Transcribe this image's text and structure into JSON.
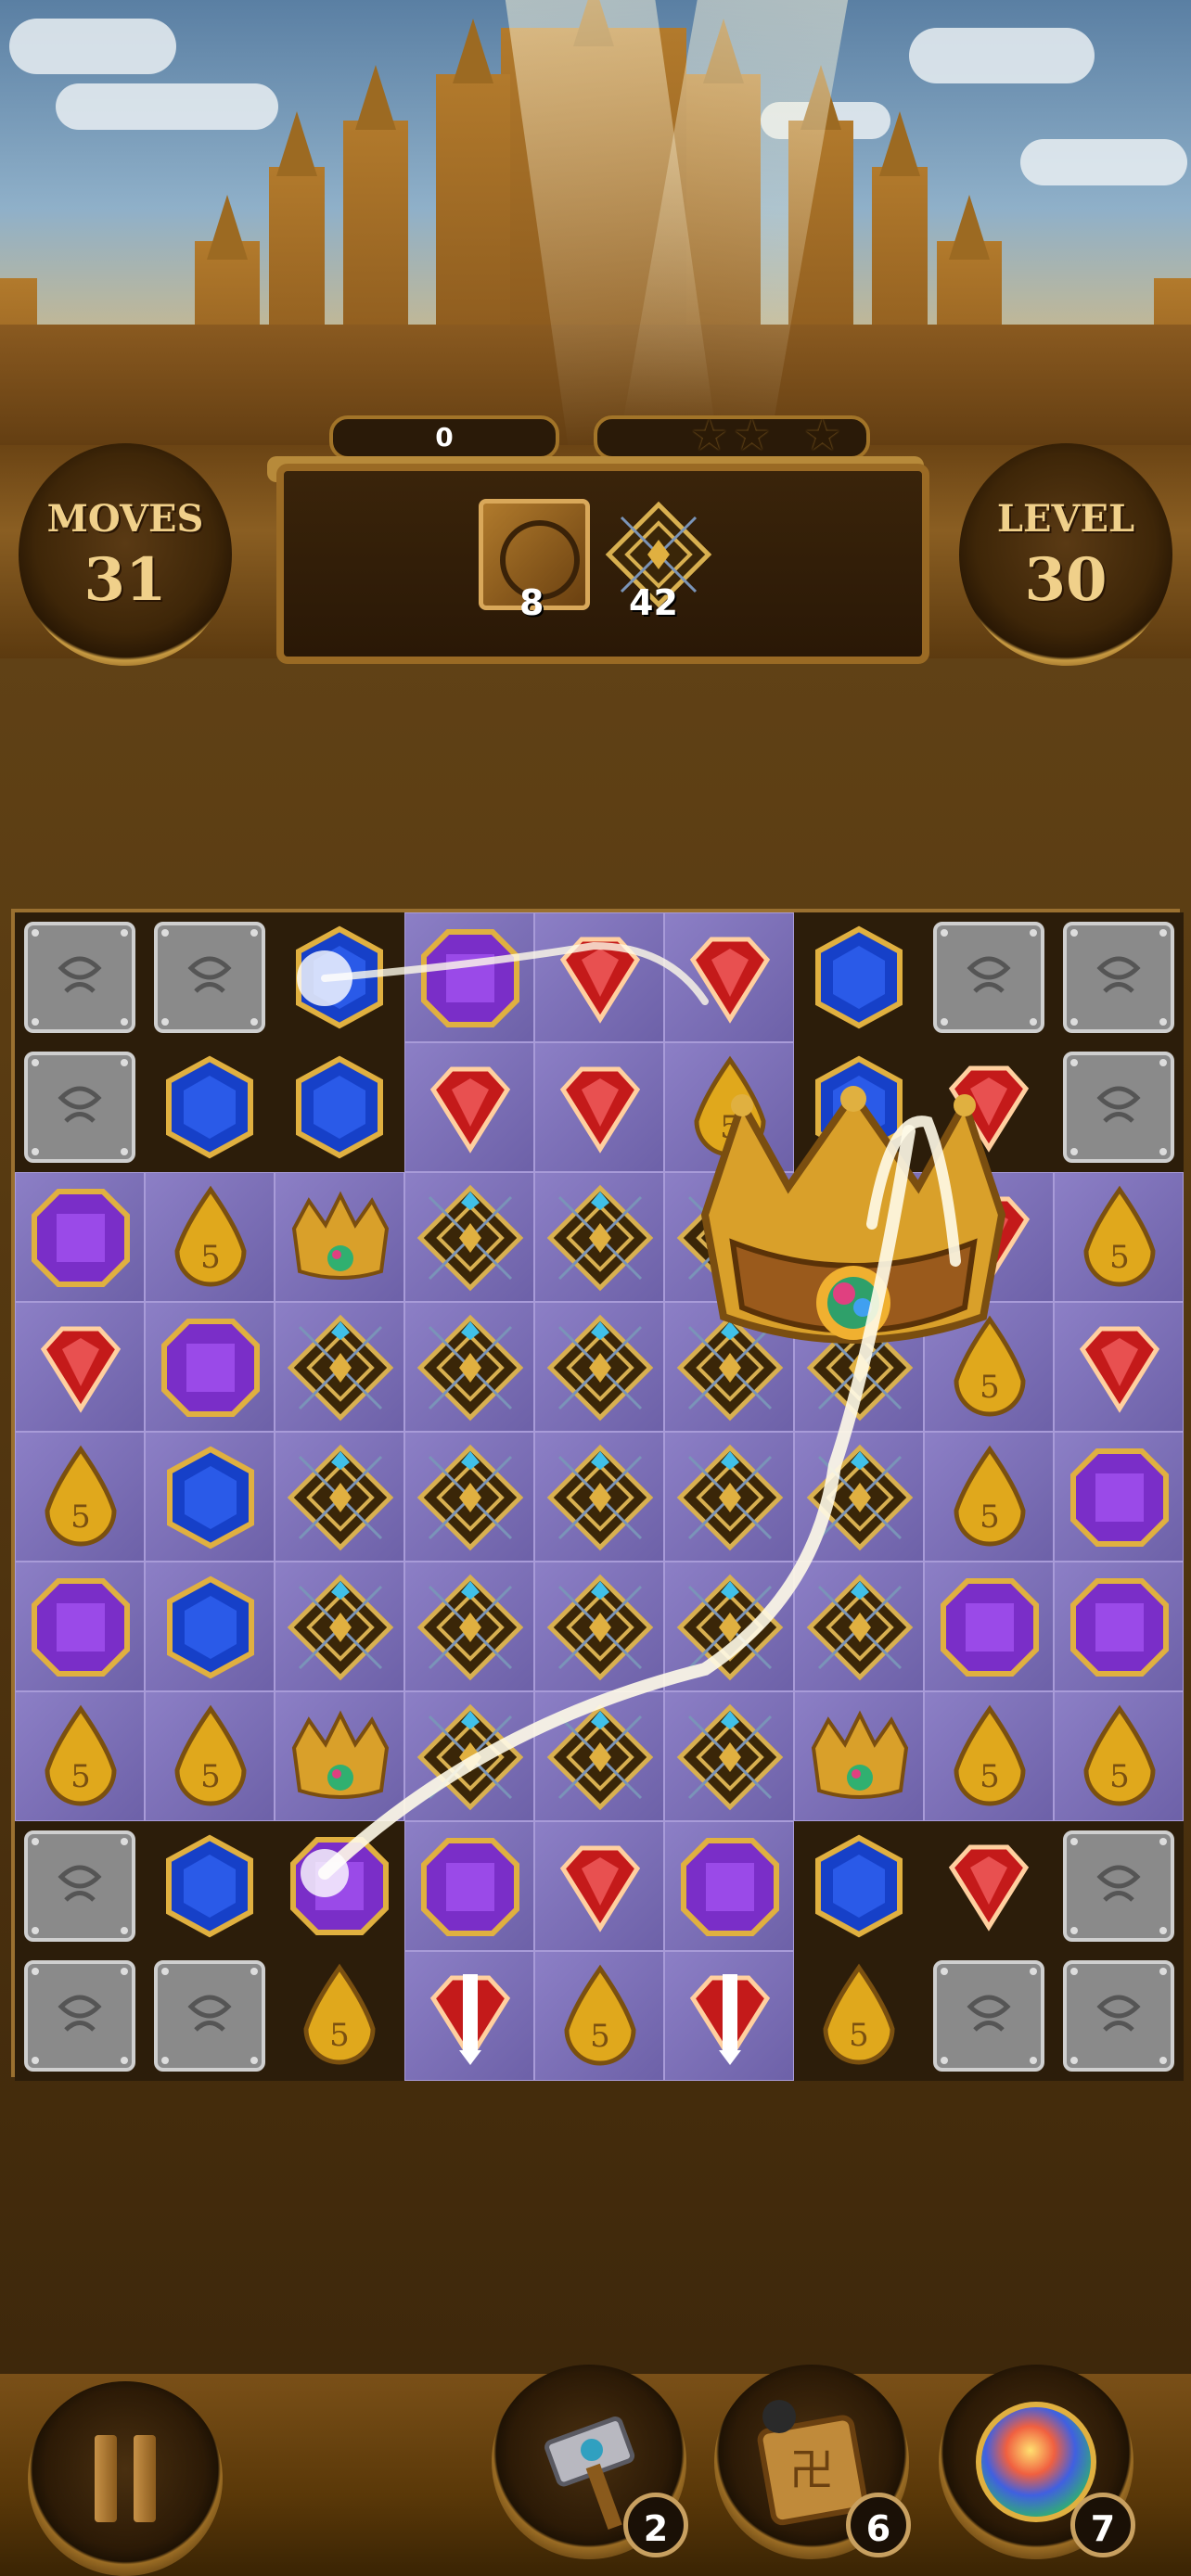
{
  "hud": {
    "score": "0",
    "moves_label": "MOVES",
    "moves_value": "31",
    "level_label": "LEVEL",
    "level_value": "30",
    "stars_earned": 0,
    "stars_total": 3
  },
  "goals": [
    {
      "name": "ornate-box",
      "count": "8"
    },
    {
      "name": "lattice-tile",
      "count": "42"
    }
  ],
  "board": {
    "rows": [
      [
        "stone",
        "stone",
        "blue",
        "purple",
        "red",
        "red",
        "blue",
        "stone",
        "stone"
      ],
      [
        "stone",
        "blue",
        "blue",
        "red",
        "red",
        "gold",
        "blue",
        "red",
        "stone"
      ],
      [
        "purple",
        "gold",
        "crown",
        "tile",
        "tile",
        "tile",
        "tile",
        "red",
        "gold"
      ],
      [
        "red",
        "purple",
        "tile",
        "tile",
        "tile",
        "tile",
        "tile",
        "gold",
        "red"
      ],
      [
        "gold",
        "blue",
        "tile",
        "tile",
        "tile",
        "tile",
        "tile",
        "gold",
        "purple"
      ],
      [
        "purple",
        "blue",
        "tile",
        "tile",
        "tile",
        "tile",
        "tile",
        "purple",
        "purple"
      ],
      [
        "gold",
        "gold",
        "crown",
        "tile",
        "tile",
        "tile",
        "crown",
        "gold",
        "gold"
      ],
      [
        "stone",
        "blue",
        "purple",
        "purple",
        "red",
        "purple",
        "blue",
        "red",
        "stone"
      ],
      [
        "stone",
        "stone",
        "gold",
        "red-arrow",
        "gold",
        "red-arrow",
        "gold",
        "stone",
        "stone"
      ]
    ],
    "backgrounds": [
      [
        "d",
        "d",
        "d",
        "p",
        "p",
        "p",
        "d",
        "d",
        "d"
      ],
      [
        "d",
        "d",
        "d",
        "p",
        "p",
        "p",
        "d",
        "d",
        "d"
      ],
      [
        "p",
        "p",
        "p",
        "p",
        "p",
        "p",
        "p",
        "p",
        "p"
      ],
      [
        "p",
        "p",
        "p",
        "p",
        "p",
        "p",
        "p",
        "p",
        "p"
      ],
      [
        "p",
        "p",
        "p",
        "p",
        "p",
        "p",
        "p",
        "p",
        "p"
      ],
      [
        "p",
        "p",
        "p",
        "p",
        "p",
        "p",
        "p",
        "p",
        "p"
      ],
      [
        "p",
        "p",
        "p",
        "p",
        "p",
        "p",
        "p",
        "p",
        "p"
      ],
      [
        "d",
        "d",
        "d",
        "p",
        "p",
        "p",
        "d",
        "d",
        "d"
      ],
      [
        "d",
        "d",
        "d",
        "p",
        "p",
        "p",
        "d",
        "d",
        "d"
      ]
    ]
  },
  "boosters": [
    {
      "name": "hammer",
      "count": "2"
    },
    {
      "name": "bomb-box",
      "count": "6"
    },
    {
      "name": "rainbow-orb",
      "count": "7"
    }
  ],
  "colors": {
    "red": "#c41a1a",
    "blue": "#1640c8",
    "purple": "#7a2ec8",
    "gold": "#e0a81c",
    "stone": "#8a8a8a",
    "frame": "#9a7030"
  }
}
